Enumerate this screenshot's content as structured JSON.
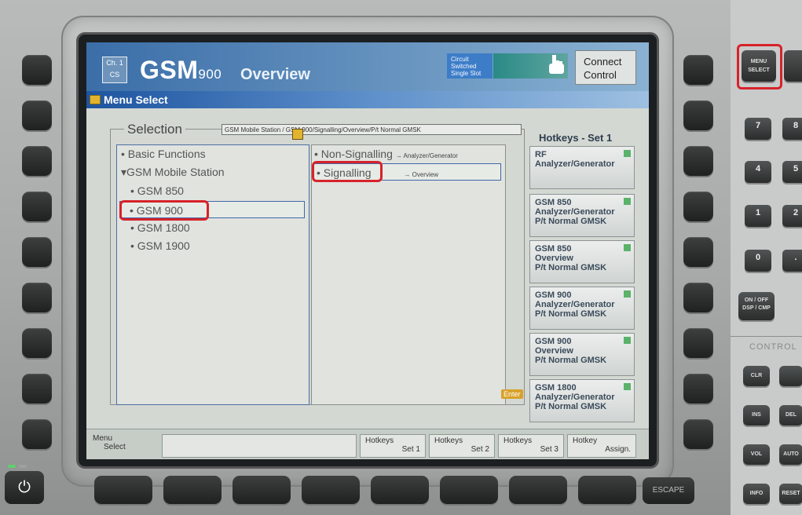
{
  "header": {
    "channel_line1": "Ch. 1",
    "channel_line2": "CS",
    "title_main": "GSM",
    "title_number": "900",
    "title_sub": "Overview",
    "circuit_line1": "Circuit",
    "circuit_line2": "Switched",
    "circuit_line3": "Single Slot",
    "connect_line1": "Connect",
    "connect_line2": "Control"
  },
  "menubar": {
    "title": "Menu Select"
  },
  "selection": {
    "legend": "Selection",
    "path": "GSM Mobile Station / GSM 900/Signalling/Overview/P/t Normal GMSK",
    "left_items": [
      "Basic Functions",
      "GSM Mobile Station",
      "GSM 850",
      "GSM 900",
      "GSM 1800",
      "GSM 1900"
    ],
    "right_items": [
      {
        "label": "Non-Signalling",
        "sub": "→ Analyzer/Generator"
      },
      {
        "label": "Signalling",
        "sub": "→ Overview"
      }
    ],
    "enter": "Enter"
  },
  "hotkeys": {
    "title": "Hotkeys - Set 1",
    "items": [
      {
        "l1": "RF",
        "l2": "Analyzer/Generator",
        "l3": ""
      },
      {
        "l1": "GSM 850",
        "l2": "Analyzer/Generator",
        "l3": "P/t Normal GMSK"
      },
      {
        "l1": "GSM 850",
        "l2": "Overview",
        "l3": "P/t Normal GMSK"
      },
      {
        "l1": "GSM 900",
        "l2": "Analyzer/Generator",
        "l3": "P/t Normal GMSK"
      },
      {
        "l1": "GSM 900",
        "l2": "Overview",
        "l3": "P/t Normal GMSK"
      },
      {
        "l1": "GSM 1800",
        "l2": "Analyzer/Generator",
        "l3": "P/t Normal GMSK"
      }
    ]
  },
  "bottom": {
    "menu_line1": "Menu",
    "menu_line2": "Select",
    "buttons": [
      {
        "l1": "Hotkeys",
        "l2": "Set 1"
      },
      {
        "l1": "Hotkeys",
        "l2": "Set 2"
      },
      {
        "l1": "Hotkeys",
        "l2": "Set 3"
      },
      {
        "l1": "Hotkey",
        "l2": "Assign."
      }
    ]
  },
  "panel": {
    "menu_select_l1": "MENU",
    "menu_select_l2": "SELECT",
    "keys": [
      "7",
      "8",
      "4",
      "5",
      "1",
      "2",
      "0",
      "."
    ],
    "on_off_l1": "ON / OFF",
    "on_off_l2": "DSP / CMP",
    "control_label": "CONTROL",
    "ctrl_keys": [
      "CLR",
      "INS",
      "DEL",
      "VOL",
      "AUTO",
      "INFO",
      "RESET"
    ],
    "escape": "ESCAPE"
  },
  "colors": {
    "highlight": "#d8222a",
    "accent_blue": "#3b6ea8",
    "status_green": "#5bb26a"
  }
}
